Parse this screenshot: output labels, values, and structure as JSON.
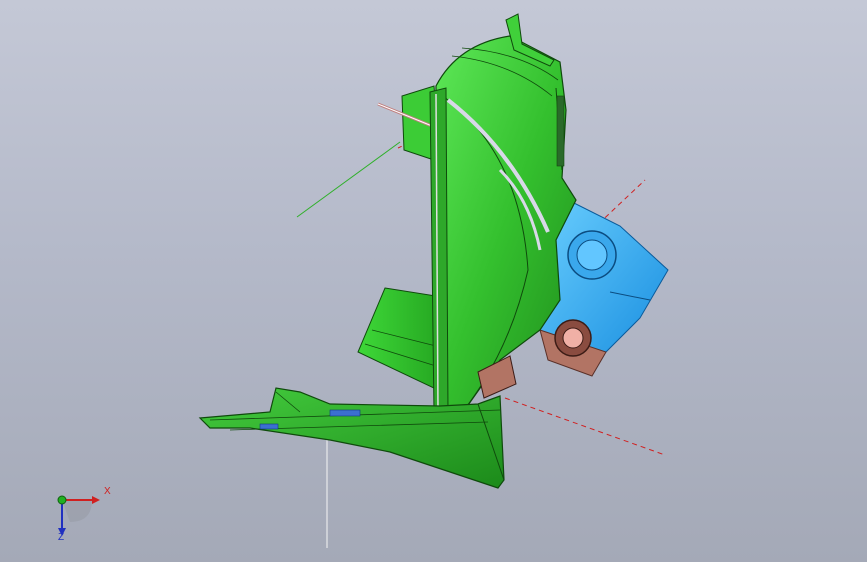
{
  "viewport": {
    "background_top": "#c4c8d6",
    "background_bottom": "#a4a9b7"
  },
  "model": {
    "main_color": "#35c030",
    "secondary_color": "#2bb0f0",
    "accent_color": "#a86a5c"
  },
  "triad": {
    "x_label": "X",
    "z_label": "Z",
    "x_color": "#d02020",
    "y_color": "#20b020",
    "z_color": "#2030c0"
  }
}
